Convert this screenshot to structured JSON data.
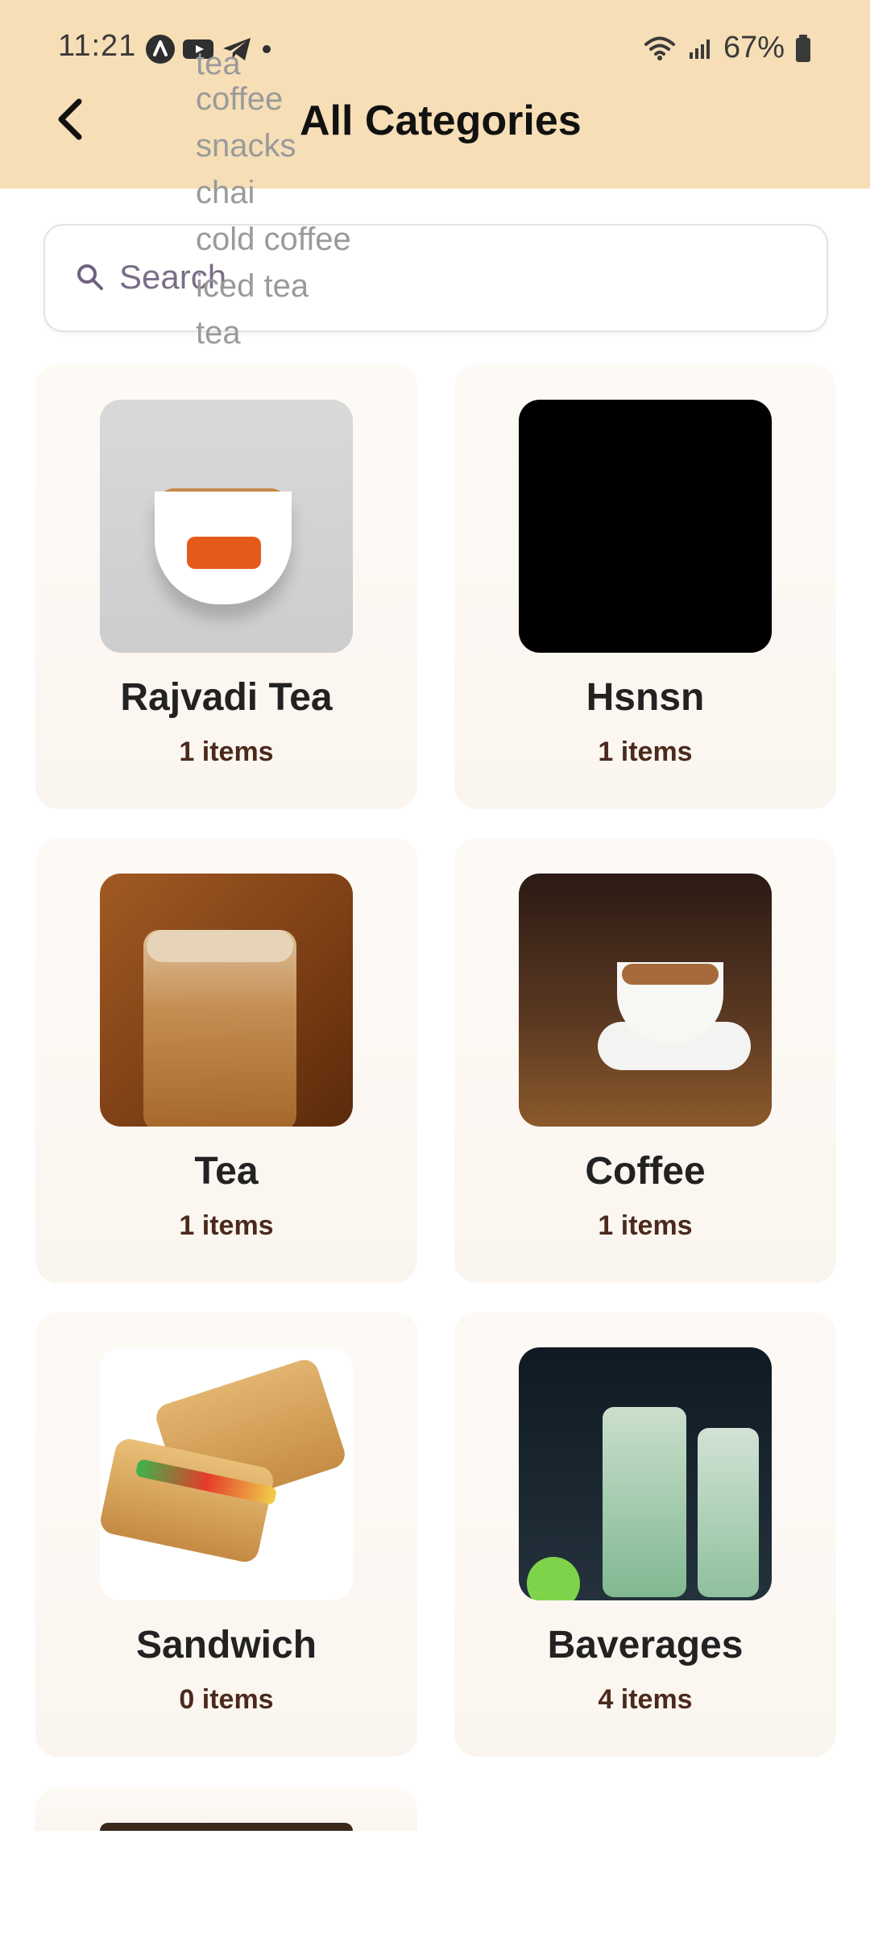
{
  "status_bar": {
    "time": "11:21",
    "battery": "67%",
    "left_icons": [
      "android-auto-icon",
      "youtube-icon",
      "telegram-icon",
      "dot-icon"
    ],
    "right_icons": [
      "wifi-icon",
      "signal-icon",
      "battery-icon"
    ]
  },
  "header": {
    "title": "All Categories",
    "back_icon": "back-chevron-icon"
  },
  "autocomplete": {
    "clipped_first": "tea",
    "items": [
      "coffee",
      "snacks",
      "chai",
      "cold coffee",
      "iced tea",
      "tea"
    ]
  },
  "search": {
    "placeholder": "Search",
    "value": "",
    "icon": "search-icon"
  },
  "categories": [
    {
      "name": "Rajvadi Tea",
      "count": "1 items",
      "thumb": "tea-cup-logo-image"
    },
    {
      "name": "Hsnsn",
      "count": "1 items",
      "thumb": "black-image"
    },
    {
      "name": "Tea",
      "count": "1 items",
      "thumb": "tea-glass-image"
    },
    {
      "name": "Coffee",
      "count": "1 items",
      "thumb": "coffee-cup-image"
    },
    {
      "name": "Sandwich",
      "count": "0 items",
      "thumb": "sandwich-image"
    },
    {
      "name": "Baverages",
      "count": "4 items",
      "thumb": "beverages-image"
    }
  ],
  "colors": {
    "header_bg": "#f6deb6",
    "card_bg": "#fbf5ef",
    "count_text": "#4b2a1d"
  }
}
